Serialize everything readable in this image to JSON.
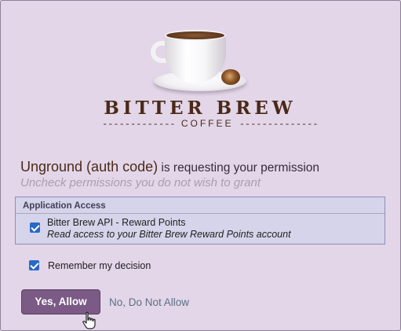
{
  "brand": {
    "name": "BITTER BREW",
    "sub_word": "COFFEE",
    "sub_left": "-------------",
    "sub_right": "--------------",
    "logo_icon": "coffee-cup-icon"
  },
  "request": {
    "app_name": "Unground (auth code)",
    "text": " is requesting your permission",
    "hint": "Uncheck permissions you do not wish to grant"
  },
  "permissions_box": {
    "title": "Application Access",
    "items": [
      {
        "name": "Bitter Brew API - Reward Points",
        "description": "Read access to your Bitter Brew Reward Points account",
        "checked": true
      }
    ]
  },
  "remember": {
    "label": "Remember my decision",
    "checked": true
  },
  "actions": {
    "allow_label": "Yes, Allow",
    "deny_label": "No, Do Not Allow"
  },
  "colors": {
    "background": "#e3d6e9",
    "accent": "#7b5a86",
    "brand": "#4a2a17",
    "checkbox": "#2868c8"
  }
}
